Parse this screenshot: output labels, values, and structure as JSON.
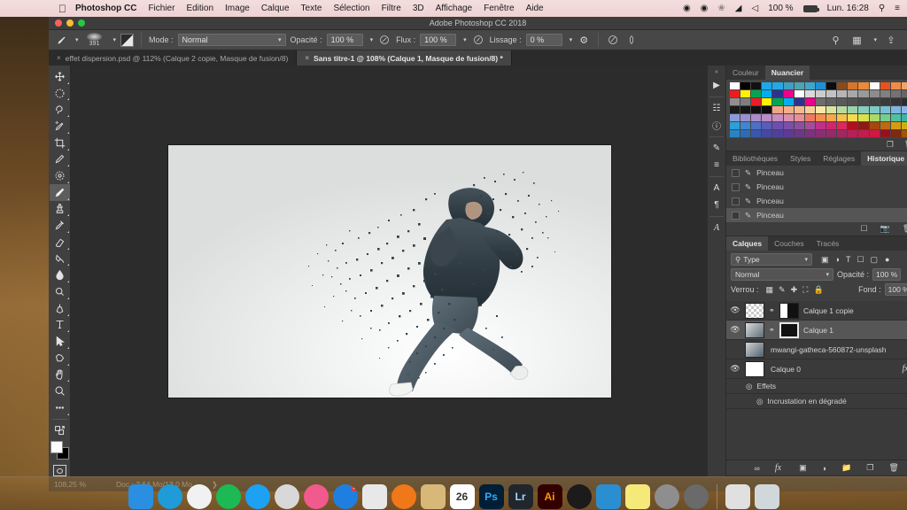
{
  "menubar": {
    "apple_icon": "apple-icon",
    "app_name": "Photoshop CC",
    "items": [
      "Fichier",
      "Edition",
      "Image",
      "Calque",
      "Texte",
      "Sélection",
      "Filtre",
      "3D",
      "Affichage",
      "Fenêtre",
      "Aide"
    ],
    "status": {
      "record_icon": "record-icon",
      "eye_icon": "eye-icon",
      "bluetooth_icon": "bluetooth-icon",
      "wifi_icon": "wifi-icon",
      "volume_icon": "volume-icon",
      "battery_percent": "100 %",
      "battery_icon": "battery-icon",
      "clock": "Lun. 16:28",
      "search_icon": "search-icon",
      "control_center_icon": "list-icon"
    }
  },
  "window": {
    "title": "Adobe Photoshop CC 2018"
  },
  "options_bar": {
    "tool_icon": "brush-icon",
    "brush_size": "391",
    "brush_preset_icon": "brush-preset-icon",
    "toggle_panel_icon": "brush-panel-icon",
    "mode_label": "Mode :",
    "mode_value": "Normal",
    "opacity_label": "Opacité :",
    "opacity_value": "100 %",
    "pressure_opacity_icon": "pressure-opacity-icon",
    "flow_label": "Flux :",
    "flow_value": "100 %",
    "airbrush_icon": "airbrush-icon",
    "smoothing_label": "Lissage :",
    "smoothing_value": "0 %",
    "smoothing_options_icon": "gear-icon",
    "pressure_size_icon": "pressure-size-icon",
    "symmetry_icon": "symmetry-icon",
    "search_icon": "search-icon",
    "workspace_icon": "workspace-icon",
    "share_icon": "share-icon"
  },
  "tabs": [
    {
      "label": "effet dispersion.psd @ 112% (Calque 2 copie, Masque de fusion/8)",
      "active": false,
      "close_icon": "close-icon"
    },
    {
      "label": "Sans titre-1 @ 108% (Calque 1, Masque de fusion/8) *",
      "active": true,
      "close_icon": "close-icon"
    }
  ],
  "toolbar": {
    "tools": [
      {
        "name": "move-tool",
        "active": false
      },
      {
        "name": "marquee-tool",
        "active": false
      },
      {
        "name": "lasso-tool",
        "active": false
      },
      {
        "name": "quick-selection-tool",
        "active": false
      },
      {
        "name": "crop-tool",
        "active": false
      },
      {
        "name": "eyedropper-tool",
        "active": false
      },
      {
        "name": "healing-brush-tool",
        "active": false
      },
      {
        "name": "brush-tool",
        "active": true
      },
      {
        "name": "clone-stamp-tool",
        "active": false
      },
      {
        "name": "history-brush-tool",
        "active": false
      },
      {
        "name": "eraser-tool",
        "active": false
      },
      {
        "name": "gradient-tool",
        "active": false
      },
      {
        "name": "blur-tool",
        "active": false
      },
      {
        "name": "dodge-tool",
        "active": false
      },
      {
        "name": "pen-tool",
        "active": false
      },
      {
        "name": "type-tool",
        "active": false
      },
      {
        "name": "path-selection-tool",
        "active": false
      },
      {
        "name": "shape-tool",
        "active": false
      },
      {
        "name": "hand-tool",
        "active": false
      },
      {
        "name": "zoom-tool",
        "active": false
      },
      {
        "name": "edit-toolbar-tool",
        "active": false
      }
    ],
    "foreground_color": "#ffffff",
    "background_color": "#000000",
    "quick_mask_icon": "quick-mask-icon"
  },
  "status_bar": {
    "zoom": "108,25 %",
    "doc_info": "Doc : 2,64 Mo/13,0 Mo",
    "arrow_icon": "chevron-right-icon"
  },
  "icon_rail": {
    "collapse_icon": "collapse-icon",
    "buttons": [
      "play-icon",
      "device-preview-icon",
      "info-icon",
      "brush-settings-icon",
      "adjustments-icon",
      "character-icon",
      "paragraph-icon",
      "glyphs-icon"
    ]
  },
  "color_panel": {
    "tabs": [
      {
        "label": "Couleur",
        "active": false
      },
      {
        "label": "Nuancier",
        "active": true
      }
    ],
    "menu_icon": "panel-menu-icon",
    "new_swatch_icon": "new-swatch-icon",
    "delete_swatch_icon": "trash-icon",
    "swatches": [
      "#ffffff",
      "#000000",
      "#111111",
      "#1fa8e8",
      "#24a9e6",
      "#3f9fc0",
      "#50a3b4",
      "#3fa6cf",
      "#1e8fd8",
      "#0c0c0c",
      "#8a4a1e",
      "#d4762c",
      "#ea8a3a",
      "#fefefe",
      "#e8531d",
      "#ef8c4a",
      "#f0a46a",
      "#e2843c",
      "#ec1c24",
      "#fff200",
      "#00a651",
      "#00aeef",
      "#2e3192",
      "#ec008c",
      "#ffffff",
      "#d9d9d9",
      "#cccccc",
      "#c2c2c2",
      "#b5b5b5",
      "#a8a8a8",
      "#9a9a9a",
      "#8d8d8d",
      "#808080",
      "#737373",
      "#666666",
      "#595959",
      "#8f8f8f",
      "#7e7e7e",
      "#ec1c24",
      "#fff200",
      "#00a651",
      "#00aeef",
      "#2e3192",
      "#ec008c",
      "#6d6d6d",
      "#626262",
      "#5a5a5a",
      "#525252",
      "#4a4a4a",
      "#424242",
      "#3a3a3a",
      "#343434",
      "#2c2c2c",
      "#242424",
      "#1a1a1a",
      "#151515",
      "#101010",
      "#0b0b0b",
      "#f0a583",
      "#f2b087",
      "#f4bb92",
      "#f7cf9e",
      "#f9e8a8",
      "#d9e59a",
      "#b8dba3",
      "#9ad3ae",
      "#86cdba",
      "#7fc9c7",
      "#77bfd5",
      "#7fb6e0",
      "#8fb4e8",
      "#9bb0e2",
      "#8a9ad8",
      "#9b8fd0",
      "#a98cc9",
      "#b98cc4",
      "#c98cbe",
      "#d98fae",
      "#e98f96",
      "#ef7a5e",
      "#f2914f",
      "#f4a84a",
      "#f6c14c",
      "#f8d94f",
      "#d7e24f",
      "#a9d96a",
      "#77cd8b",
      "#4ec09e",
      "#3bb3a8",
      "#3aa7b0",
      "#2e9fd8",
      "#3f86d0",
      "#4f6fc4",
      "#5b5bb8",
      "#6a4fae",
      "#7b4fa8",
      "#8c4f9f",
      "#a24f96",
      "#c0308a",
      "#d4246e",
      "#e0275a",
      "#b01020",
      "#8f1a14",
      "#a3480f",
      "#c06a10",
      "#d89a12",
      "#c7b215",
      "#9fae1a",
      "#2a84c4",
      "#2f6ab8",
      "#3a57ae",
      "#4549a4",
      "#51409b",
      "#5e3a92",
      "#6d3688",
      "#7c327e",
      "#8a2e74",
      "#98296a",
      "#a62560",
      "#b42156",
      "#c21d4c",
      "#d01942",
      "#9a0f20",
      "#7f2a10",
      "#a0550c",
      "#b9790e"
    ]
  },
  "history_panel": {
    "tabs": [
      {
        "label": "Bibliothèques",
        "active": false
      },
      {
        "label": "Styles",
        "active": false
      },
      {
        "label": "Réglages",
        "active": false
      },
      {
        "label": "Historique",
        "active": true
      }
    ],
    "menu_icon": "panel-menu-icon",
    "items": [
      {
        "label": "Pinceau",
        "icon": "brush-icon",
        "selected": false
      },
      {
        "label": "Pinceau",
        "icon": "brush-icon",
        "selected": false
      },
      {
        "label": "Pinceau",
        "icon": "brush-icon",
        "selected": false
      },
      {
        "label": "Pinceau",
        "icon": "brush-icon",
        "selected": true
      }
    ],
    "footer_icons": [
      "new-document-from-state-icon",
      "camera-snapshot-icon",
      "trash-icon"
    ]
  },
  "layers_panel": {
    "tabs": [
      {
        "label": "Calques",
        "active": true
      },
      {
        "label": "Couches",
        "active": false
      },
      {
        "label": "Tracés",
        "active": false
      }
    ],
    "menu_icon": "panel-menu-icon",
    "filter_label": "Type",
    "filter_search_icon": "search-icon",
    "filter_icons": [
      "pixel-filter-icon",
      "adjustment-filter-icon",
      "type-filter-icon",
      "shape-filter-icon",
      "smart-object-filter-icon"
    ],
    "filter_toggle_icon": "filter-toggle-icon",
    "blend_mode": "Normal",
    "opacity_label": "Opacité :",
    "opacity_value": "100 %",
    "lock_label": "Verrou :",
    "lock_icons": [
      "lock-transparent-icon",
      "lock-image-icon",
      "lock-position-icon",
      "lock-artboard-icon",
      "lock-all-icon"
    ],
    "fill_label": "Fond :",
    "fill_value": "100 %",
    "layers": [
      {
        "name": "Calque 1 copie",
        "visible": true,
        "selected": false,
        "linked": true,
        "has_mask": true,
        "mask_selected": false,
        "thumb_type": "checker"
      },
      {
        "name": "Calque 1",
        "visible": true,
        "selected": true,
        "linked": true,
        "has_mask": true,
        "mask_selected": true,
        "thumb_type": "photo"
      },
      {
        "name": "mwangi-gatheca-560872-unsplash",
        "visible": false,
        "selected": false,
        "linked": false,
        "has_mask": false,
        "mask_selected": false,
        "thumb_type": "photo-small"
      },
      {
        "name": "Calque 0",
        "visible": true,
        "selected": false,
        "linked": false,
        "has_mask": false,
        "mask_selected": false,
        "thumb_type": "white",
        "fx_label": "fx",
        "expand_icon": "chevron-up-icon"
      }
    ],
    "effects_group": {
      "label": "Effets",
      "eye_icon": "eye-icon",
      "children": [
        {
          "label": "Incrustation en dégradé",
          "eye_icon": "eye-icon"
        }
      ]
    },
    "footer_icons": [
      "link-layers-icon",
      "layer-style-icon",
      "layer-mask-icon",
      "adjustment-layer-icon",
      "new-group-icon",
      "new-layer-icon",
      "trash-icon"
    ]
  },
  "dock": {
    "items": [
      {
        "name": "finder",
        "label": "",
        "color": "#2a8fe0",
        "running": true
      },
      {
        "name": "safari",
        "label": "",
        "color": "#1f9bd8",
        "running": true
      },
      {
        "name": "chrome",
        "label": "",
        "color": "#f1f1f1",
        "running": true
      },
      {
        "name": "spotify",
        "label": "",
        "color": "#1db954",
        "running": false
      },
      {
        "name": "twitter",
        "label": "",
        "color": "#1da1f2",
        "running": false
      },
      {
        "name": "messages",
        "label": "",
        "color": "#d8d8d8",
        "running": false
      },
      {
        "name": "itunes",
        "label": "",
        "color": "#f05a8c",
        "running": false
      },
      {
        "name": "app-store",
        "label": "",
        "color": "#1f7fe0",
        "running": false,
        "badge": "1"
      },
      {
        "name": "photos",
        "label": "",
        "color": "#e8e8e8",
        "running": false
      },
      {
        "name": "ibooks",
        "label": "",
        "color": "#f07818",
        "running": false
      },
      {
        "name": "notes-folder",
        "label": "",
        "color": "#d8b878",
        "running": false
      },
      {
        "name": "calendar",
        "label": "26",
        "color": "#ffffff",
        "running": false
      },
      {
        "name": "photoshop",
        "label": "Ps",
        "color": "#001e36",
        "running": true
      },
      {
        "name": "lightroom",
        "label": "Lr",
        "color": "#20262c",
        "running": false
      },
      {
        "name": "illustrator",
        "label": "Ai",
        "color": "#330000",
        "running": false
      },
      {
        "name": "quicktime",
        "label": "",
        "color": "#1b1b1b",
        "running": true
      },
      {
        "name": "keynote",
        "label": "",
        "color": "#2a8fd0",
        "running": false
      },
      {
        "name": "stickies",
        "label": "",
        "color": "#f5e97a",
        "running": false
      },
      {
        "name": "system-preferences",
        "label": "",
        "color": "#8e8e8e",
        "running": false
      },
      {
        "name": "launchpad",
        "label": "",
        "color": "#6a6a6a",
        "running": false
      }
    ],
    "separator": true,
    "right_items": [
      {
        "name": "downloads-stack",
        "label": "",
        "color": "#e0e0e0"
      },
      {
        "name": "trash",
        "label": "",
        "color": "#d0d8dc"
      }
    ]
  }
}
